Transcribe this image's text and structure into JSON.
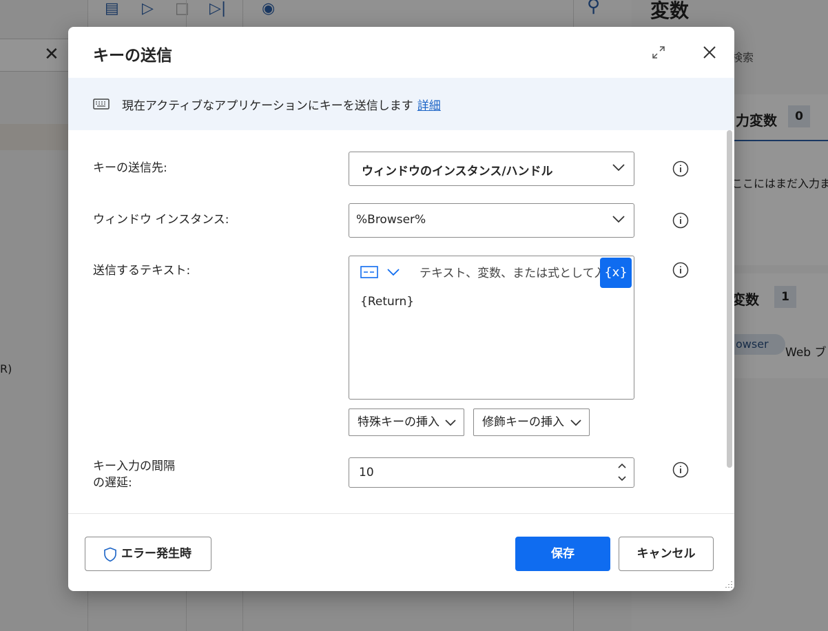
{
  "background": {
    "panel_title": "変数",
    "search_placeholder": "検索",
    "input_vars_header": "力変数",
    "input_vars_count": "0",
    "input_vars_empty": "ここにはまだ入力ま",
    "flow_vars_header": "変数",
    "flow_vars_count": "1",
    "chip_label": "owser",
    "chip_type": "Web ブ",
    "left_fragment": "R)"
  },
  "dialog": {
    "title": "キーの送信",
    "banner_text": "現在アクティブなアプリケーションにキーを送信します",
    "banner_link": "詳細",
    "fields": {
      "target_label": "キーの送信先:",
      "target_value": "ウィンドウのインスタンス/ハンドル",
      "instance_label": "ウィンドウ インスタンス:",
      "instance_value": "%Browser%",
      "text_label": "送信するテキスト:",
      "text_placeholder": "テキスト、変数、または式として入力",
      "text_var_button": "{x}",
      "text_value": "{Return}",
      "special_key_label": "特殊キーの挿入",
      "modifier_key_label": "修飾キーの挿入",
      "delay_label_line1": "キー入力の間隔",
      "delay_label_line2": "の遅延:",
      "delay_value": "10"
    },
    "buttons": {
      "on_error": "エラー発生時",
      "save": "保存",
      "cancel": "キャンセル"
    }
  },
  "colors": {
    "accent": "#0f6cf0",
    "link": "#1a63c6",
    "banner_bg": "#eff4fb"
  }
}
